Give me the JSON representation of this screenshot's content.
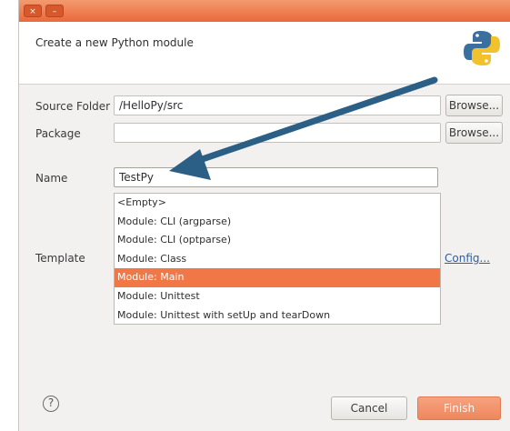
{
  "titlebar": {
    "close_glyph": "×",
    "minimize_glyph": "–"
  },
  "header": {
    "title": "Create a new Python module",
    "logo_icon": "python-logo-icon"
  },
  "form": {
    "source_folder": {
      "label": "Source Folder",
      "value": "/HelloPy/src",
      "browse_label": "Browse..."
    },
    "package": {
      "label": "Package",
      "value": "",
      "browse_label": "Browse..."
    },
    "name": {
      "label": "Name",
      "value": "TestPy"
    },
    "template": {
      "label": "Template",
      "config_label": "Config...",
      "options": [
        "<Empty>",
        "Module: CLI (argparse)",
        "Module: CLI (optparse)",
        "Module: Class",
        "Module: Main",
        "Module: Unittest",
        "Module: Unittest with setUp and tearDown"
      ],
      "selected": "Module: Main"
    }
  },
  "footer": {
    "help_glyph": "?",
    "cancel_label": "Cancel",
    "finish_label": "Finish"
  },
  "colors": {
    "accent": "#f07746",
    "arrow": "#2b5f85",
    "titlebar": "#e9693a"
  }
}
